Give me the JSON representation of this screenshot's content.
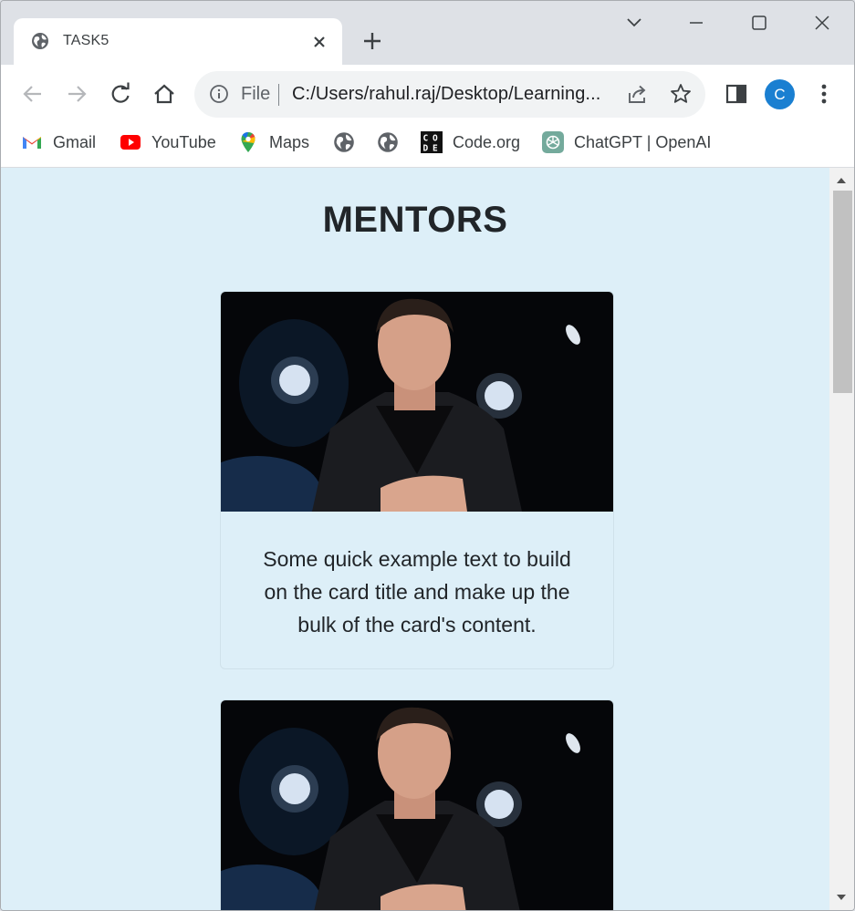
{
  "browser": {
    "tab_title": "TASK5",
    "omnibox": {
      "scheme_label": "File",
      "url_text": "C:/Users/rahul.raj/Desktop/Learning..."
    },
    "profile_initial": "C",
    "profile_color": "#1a7fd1",
    "bookmarks": [
      {
        "label": "Gmail",
        "icon": "gmail-icon"
      },
      {
        "label": "YouTube",
        "icon": "youtube-icon"
      },
      {
        "label": "Maps",
        "icon": "maps-icon"
      },
      {
        "label": "",
        "icon": "globe-icon"
      },
      {
        "label": "",
        "icon": "globe-icon"
      },
      {
        "label": "Code.org",
        "icon": "code-org-icon"
      },
      {
        "label": "ChatGPT | OpenAI",
        "icon": "chatgpt-icon"
      }
    ]
  },
  "page": {
    "heading": "MENTORS",
    "background_color": "#ddeff8",
    "cards": [
      {
        "image_subject": "person-photo",
        "text": "Some quick example text to build on the card title and make up the bulk of the card's content."
      },
      {
        "image_subject": "person-photo",
        "text": ""
      }
    ]
  }
}
